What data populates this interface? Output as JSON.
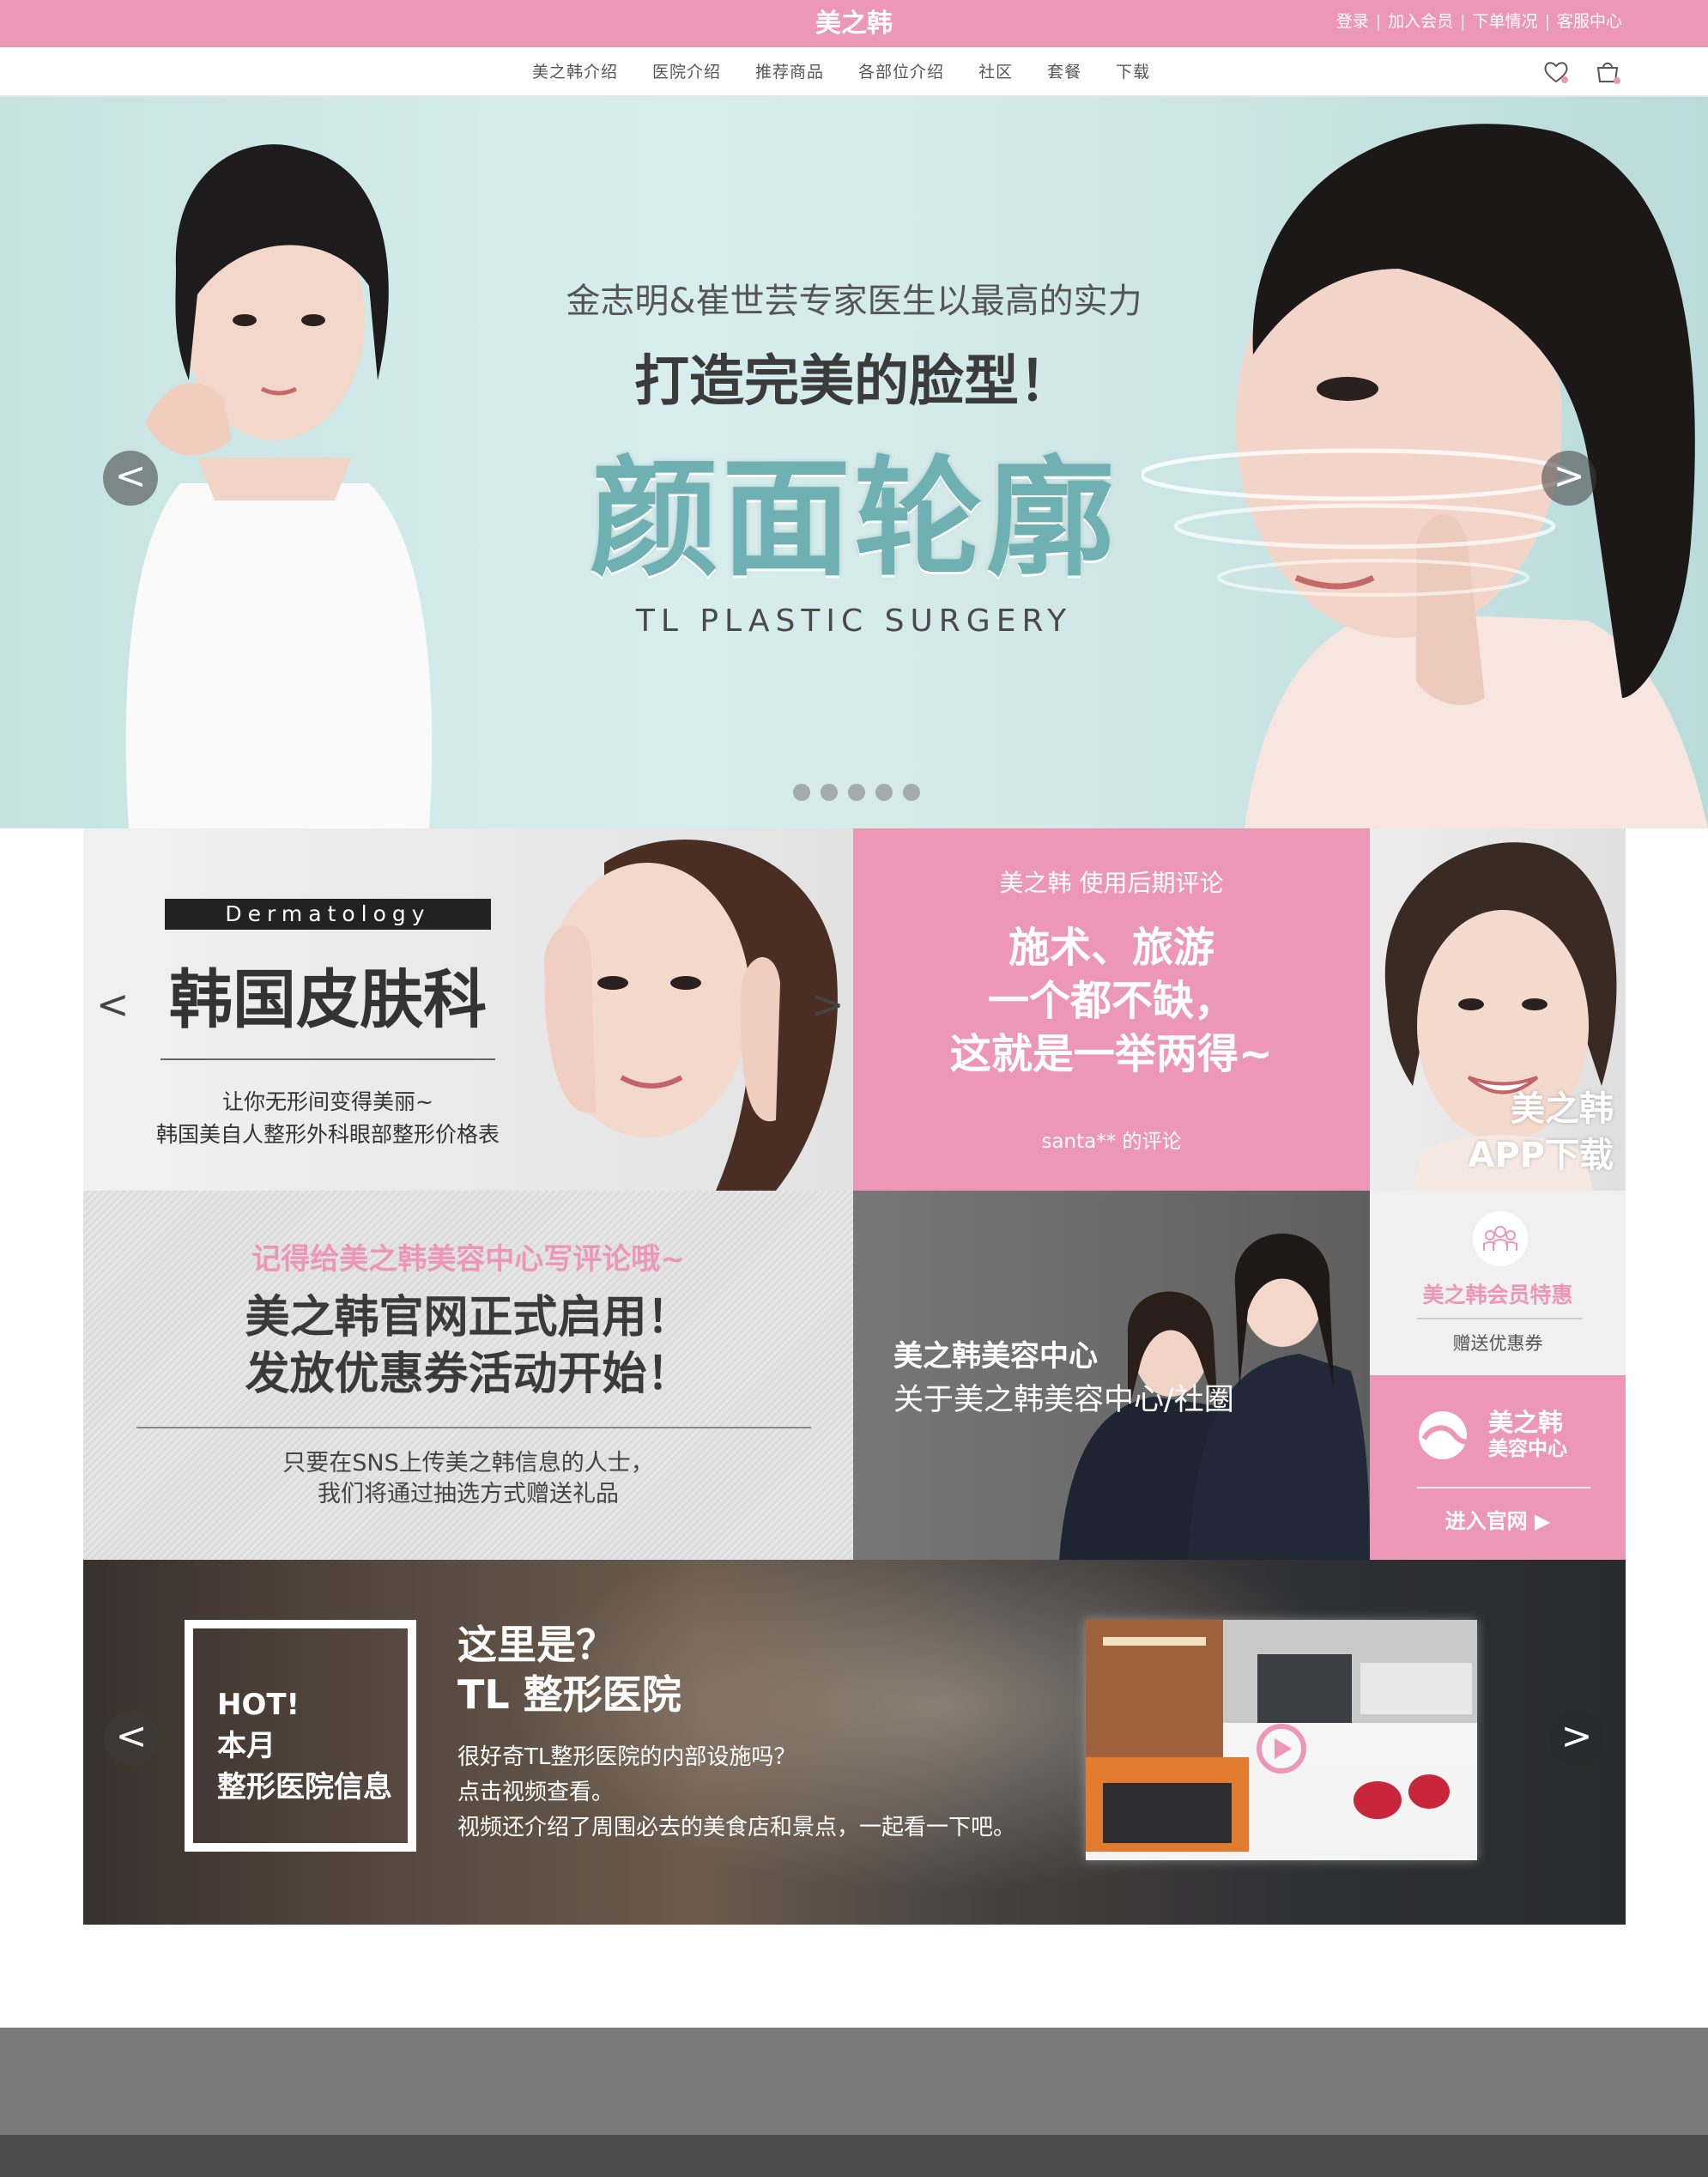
{
  "header": {
    "brand": "美之韩",
    "links": [
      "登录",
      "加入会员",
      "下单情况",
      "客服中心"
    ],
    "separator": "|"
  },
  "nav": {
    "items": [
      "美之韩介绍",
      "医院介绍",
      "推荐商品",
      "各部位介绍",
      "社区",
      "套餐",
      "下载"
    ],
    "icons": [
      "heart-icon",
      "cart-icon"
    ]
  },
  "hero": {
    "subtitle": "金志明&崔世芸专家医生以最高的实力",
    "heading": "打造完美的脸型！",
    "title": "颜面轮廓",
    "english": "TL PLASTIC SURGERY",
    "prev": "<",
    "next": ">",
    "slide_count": 5
  },
  "derm": {
    "tag": "Dermatology",
    "title": "韩国皮肤科",
    "line1": "让你无形间变得美丽~",
    "line2": "韩国美自人整形外科眼部整形价格表",
    "prev": "<",
    "next": ">"
  },
  "review": {
    "heading": "美之韩 使用后期评论",
    "line1": "施术、旅游",
    "line2": "一个都不缺，",
    "line3": "这就是一举两得~",
    "footer": "santa** 的评论"
  },
  "app": {
    "line1": "美之韩",
    "line2": "APP下载"
  },
  "event": {
    "heading": "记得给美之韩美容中心写评论哦~",
    "line1": "美之韩官网正式启用！",
    "line2": "发放优惠券活动开始！",
    "p1": "只要在SNS上传美之韩信息的人士，",
    "p2": "我们将通过抽选方式赠送礼品"
  },
  "center": {
    "heading": "美之韩美容中心",
    "sub": "关于美之韩美容中心/社圈"
  },
  "member": {
    "title": "美之韩会员特惠",
    "sub": "赠送优惠券"
  },
  "official": {
    "name1": "美之韩",
    "name2": "美容中心",
    "button": "进入官网 ▶"
  },
  "hospital": {
    "box1": "HOT!",
    "box2": "本月",
    "box3": "整形医院信息",
    "h1": "这里是？",
    "h2": "TL 整形医院",
    "p1": "很好奇TL整形医院的内部设施吗？",
    "p2": "点击视频查看。",
    "p3": "视频还介绍了周围必去的美食店和景点，一起看一下吧。",
    "prev": "<",
    "next": ">"
  },
  "colors": {
    "accent": "#ec97b6",
    "teal": "#6fb0b2",
    "footer": "#7a7a7a",
    "footer_dark": "#4b4b4b"
  }
}
